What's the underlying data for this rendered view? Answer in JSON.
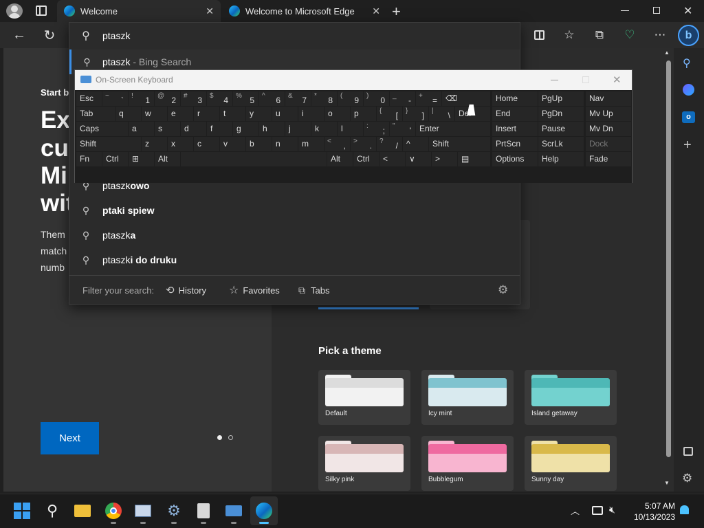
{
  "tabs": [
    {
      "title": "Welcome",
      "active": true
    },
    {
      "title": "Welcome to Microsoft Edge",
      "active": false
    }
  ],
  "address": {
    "value": "ptaszk"
  },
  "suggestions": {
    "bing": {
      "query": "ptaszk",
      "suffix": " - Bing Search"
    },
    "items": [
      {
        "prefix": "ptaszk",
        "bold": "owo"
      },
      {
        "prefix": "",
        "bold": "ptaki spiew"
      },
      {
        "prefix": "ptaszk",
        "bold": "a"
      },
      {
        "prefix": "ptaszk",
        "bold": "i do druku"
      }
    ]
  },
  "filter": {
    "label": "Filter your search:",
    "history": "History",
    "favorites": "Favorites",
    "tabs": "Tabs"
  },
  "osk": {
    "title": "On-Screen Keyboard"
  },
  "welcome": {
    "start": "Start b",
    "heading": [
      "Exp",
      "cus",
      "Mi",
      "wit"
    ],
    "body": [
      "Them",
      "match",
      "numb"
    ],
    "next": "Next"
  },
  "themes": {
    "title": "Pick a theme",
    "items": [
      {
        "name": "Default",
        "color": "#f2f2f2",
        "tab": "#dcdcdc"
      },
      {
        "name": "Icy mint",
        "color": "#d9eaef",
        "tab": "#7fc3cf"
      },
      {
        "name": "Island getaway",
        "color": "#73d2cf",
        "tab": "#4eb8b6"
      },
      {
        "name": "Silky pink",
        "color": "#f1e6e6",
        "tab": "#d8b6b6"
      },
      {
        "name": "Bubblegum",
        "color": "#f8b5d0",
        "tab": "#ef6aa0"
      },
      {
        "name": "Sunny day",
        "color": "#efe1a8",
        "tab": "#d9b94a"
      }
    ]
  },
  "clock": {
    "time": "5:07 AM",
    "date": "10/13/2023"
  },
  "colors": {
    "accent": "#0067c0",
    "edge": "#0b67c0"
  }
}
